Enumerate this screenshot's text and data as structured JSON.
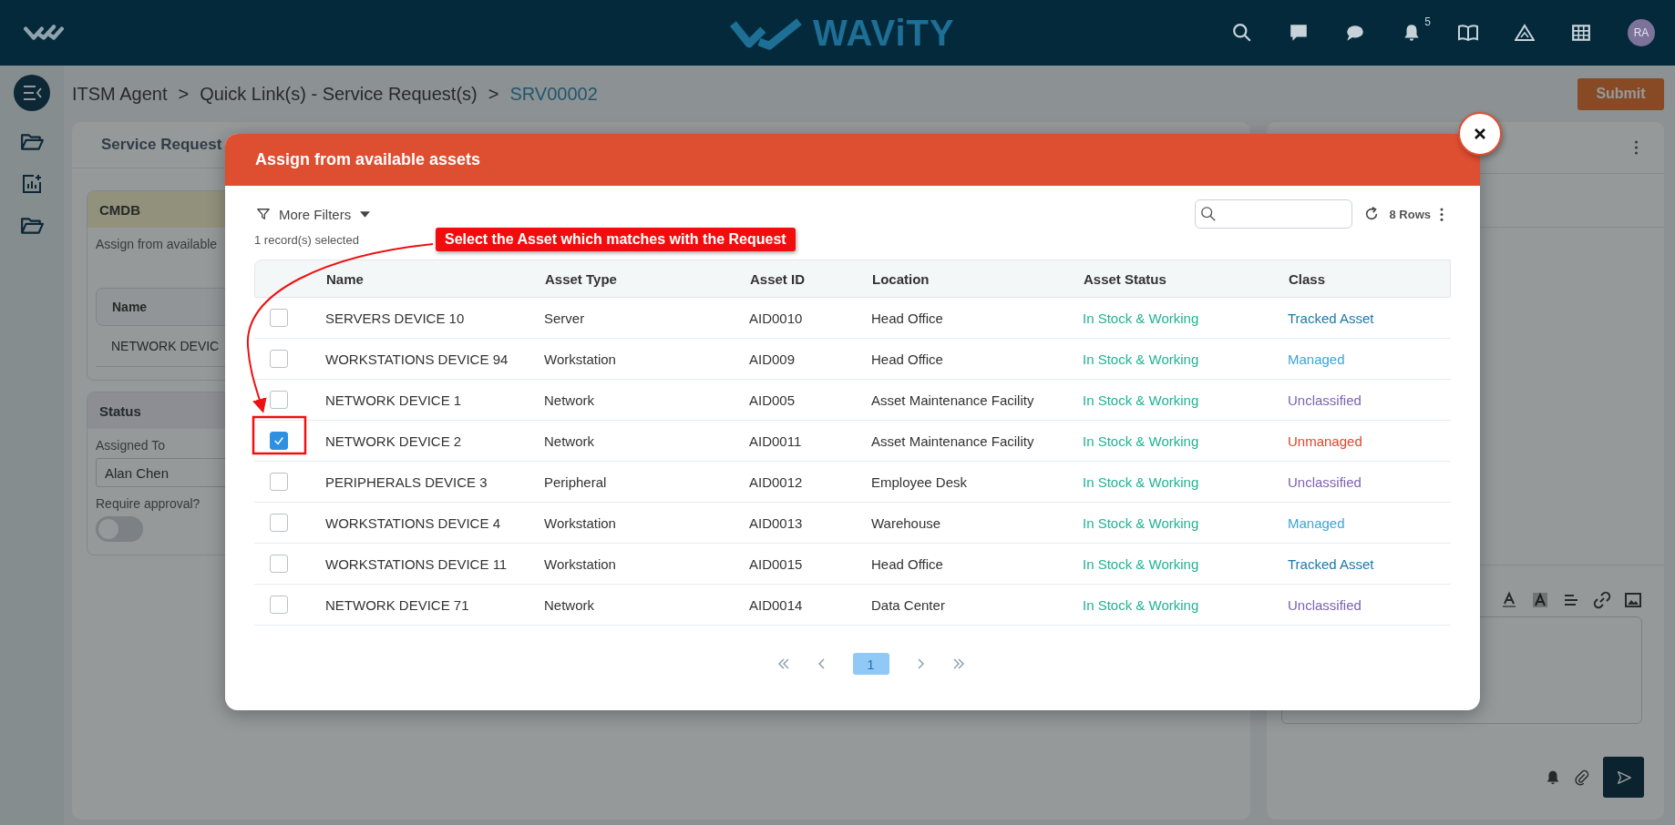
{
  "topbar": {
    "brand": "WAViTY",
    "notifications": "5",
    "avatar": "RA"
  },
  "breadcrumb": [
    {
      "kind": "link",
      "label": "ITSM Agent"
    },
    {
      "kind": "separator",
      "label": ">"
    },
    {
      "kind": "link",
      "label": "Quick Link(s) - Service Request(s)"
    },
    {
      "kind": "separator",
      "label": ">"
    },
    {
      "kind": "current",
      "label": "SRV00002"
    }
  ],
  "submit": "Submit",
  "left_card": {
    "tab": "Service Request",
    "cmdb": {
      "title": "CMDB",
      "text": "Assign from available",
      "column": "Name",
      "cell": "NETWORK DEVIC"
    },
    "status": {
      "title": "Status",
      "assigned_label": "Assigned To",
      "assigned_value": "Alan Chen",
      "approval_label": "Require approval?",
      "approval_on": false
    }
  },
  "modal": {
    "title": "Assign from available assets",
    "filters": "More Filters",
    "rows_label": "8 Rows",
    "selected_text": "1 record(s) selected",
    "columns": [
      "Name",
      "Asset Type",
      "Asset ID",
      "Location",
      "Asset Status",
      "Class"
    ],
    "rows": [
      {
        "name": "SERVERS DEVICE 10",
        "type": "Server",
        "id": "AID0010",
        "location": "Head Office",
        "status": "In Stock & Working",
        "class": "Tracked Asset",
        "color": "#1a78ad",
        "selected": false
      },
      {
        "name": "WORKSTATIONS DEVICE 94",
        "type": "Workstation",
        "id": "AID009",
        "location": "Head Office",
        "status": "In Stock & Working",
        "class": "Managed",
        "color": "#3aa5d6",
        "selected": false
      },
      {
        "name": "NETWORK DEVICE 1",
        "type": "Network",
        "id": "AID005",
        "location": "Asset Maintenance Facility",
        "status": "In Stock & Working",
        "class": "Unclassified",
        "color": "#7d62b0",
        "selected": false
      },
      {
        "name": "NETWORK DEVICE 2",
        "type": "Network",
        "id": "AID0011",
        "location": "Asset Maintenance Facility",
        "status": "In Stock & Working",
        "class": "Unmanaged",
        "color": "#e0452b",
        "selected": true
      },
      {
        "name": "PERIPHERALS DEVICE 3",
        "type": "Peripheral",
        "id": "AID0012",
        "location": "Employee Desk",
        "status": "In Stock & Working",
        "class": "Unclassified",
        "color": "#7d62b0",
        "selected": false
      },
      {
        "name": "WORKSTATIONS DEVICE 4",
        "type": "Workstation",
        "id": "AID0013",
        "location": "Warehouse",
        "status": "In Stock & Working",
        "class": "Managed",
        "color": "#3aa5d6",
        "selected": false
      },
      {
        "name": "WORKSTATIONS DEVICE 11",
        "type": "Workstation",
        "id": "AID0015",
        "location": "Head Office",
        "status": "In Stock & Working",
        "class": "Tracked Asset",
        "color": "#1a78ad",
        "selected": false
      },
      {
        "name": "NETWORK DEVICE 71",
        "type": "Network",
        "id": "AID0014",
        "location": "Data Center",
        "status": "In Stock & Working",
        "class": "Unclassified",
        "color": "#7d62b0",
        "selected": false
      }
    ],
    "pages": [
      {
        "label": "1",
        "selected": true
      }
    ]
  },
  "annotation": {
    "text": "Select the Asset which matches with the Request"
  }
}
